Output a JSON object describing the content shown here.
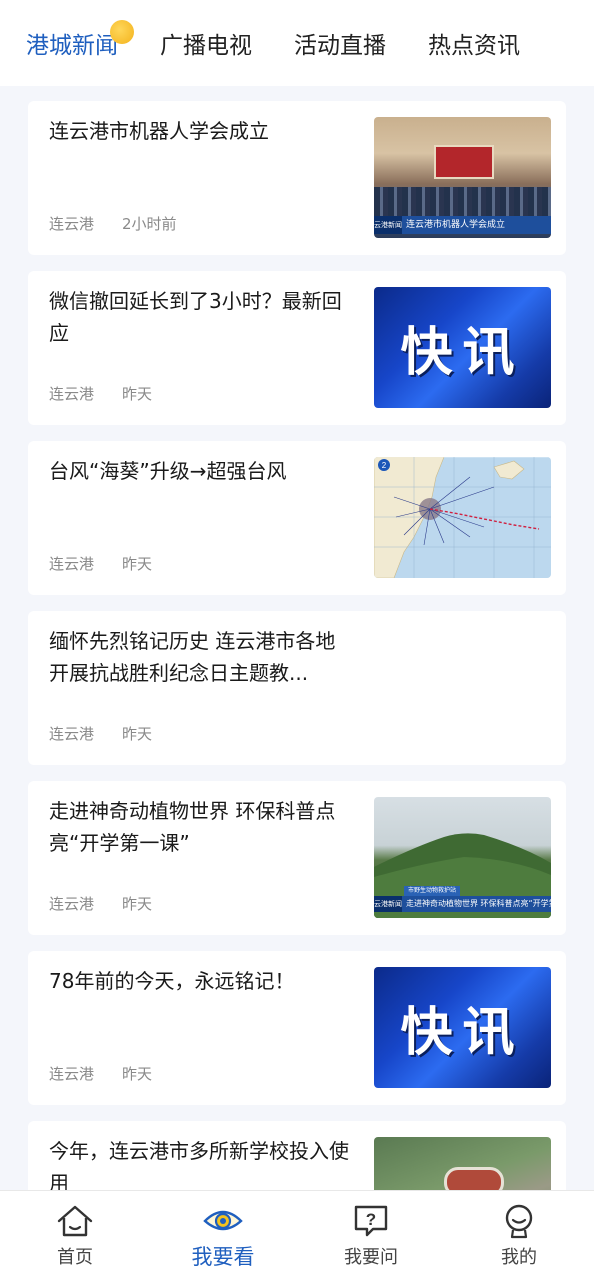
{
  "tabs": [
    {
      "label": "港城新闻",
      "active": true
    },
    {
      "label": "广播电视",
      "active": false
    },
    {
      "label": "活动直播",
      "active": false
    },
    {
      "label": "热点资讯",
      "active": false
    }
  ],
  "articles": [
    {
      "title": "连云港市机器人学会成立",
      "source": "连云港",
      "time": "2小时前",
      "thumb": "meeting-photo"
    },
    {
      "title": "微信撤回延长到了3小时？最新回应",
      "source": "连云港",
      "time": "昨天",
      "thumb": "flash-news",
      "thumb_text": "快讯"
    },
    {
      "title": "台风“海葵”升级→超强台风",
      "source": "连云港",
      "time": "昨天",
      "thumb": "typhoon-map"
    },
    {
      "title": "缅怀先烈铭记历史 连云港市各地开展抗战胜利纪念日主题教...",
      "source": "连云港",
      "time": "昨天",
      "thumb": null
    },
    {
      "title": "走进神奇动植物世界 环保科普点亮“开学第一课”",
      "source": "连云港",
      "time": "昨天",
      "thumb": "hill-photo"
    },
    {
      "title": "78年前的今天，永远铭记！",
      "source": "连云港",
      "time": "昨天",
      "thumb": "flash-news",
      "thumb_text": "快讯"
    },
    {
      "title": "今年，连云港市多所新学校投入使用",
      "source": "",
      "time": "",
      "thumb": "aerial-photo"
    }
  ],
  "thumb_captions": {
    "meeting_logo": "云港新闻",
    "meeting_banner": "连云港市机器人学会成立",
    "hill_logo": "云港新闻",
    "hill_sub": "市野生动物救护站",
    "hill_bar": "走进神奇动植物世界 环保科普点亮“开学第一课”"
  },
  "bottom_nav": [
    {
      "label": "首页",
      "icon": "home-icon",
      "active": false
    },
    {
      "label": "我要看",
      "icon": "eye-icon",
      "active": true
    },
    {
      "label": "我要问",
      "icon": "question-icon",
      "active": false
    },
    {
      "label": "我的",
      "icon": "profile-icon",
      "active": false
    }
  ],
  "colors": {
    "accent": "#1f5fbf",
    "background": "#f4f6fb",
    "card": "#ffffff",
    "meta": "#8a8a8a"
  }
}
